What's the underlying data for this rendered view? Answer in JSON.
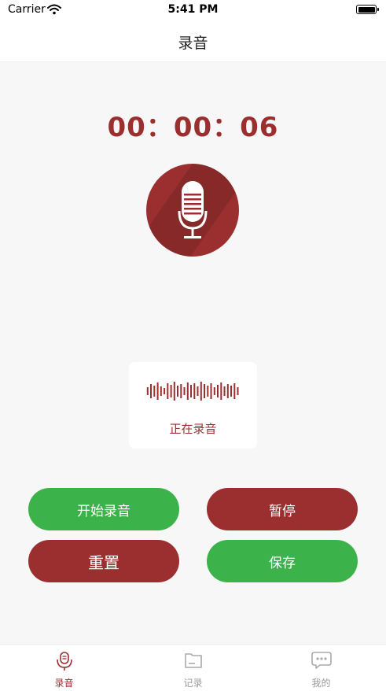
{
  "status_bar": {
    "carrier": "Carrier",
    "time": "5:41 PM"
  },
  "nav": {
    "title": "录音"
  },
  "timer": "00：00：06",
  "recording_card": {
    "status_text": "正在录音"
  },
  "buttons": {
    "start": "开始录音",
    "pause": "暂停",
    "reset": "重置",
    "save": "保存"
  },
  "tabs": [
    {
      "label": "录音",
      "icon": "mic-tab-icon",
      "active": true
    },
    {
      "label": "记录",
      "icon": "folder-icon",
      "active": false
    },
    {
      "label": "我的",
      "icon": "chat-bubble-icon",
      "active": false
    }
  ],
  "colors": {
    "accent": "#9b2f2f",
    "green": "#3cb34a",
    "background": "#f7f7f7"
  }
}
